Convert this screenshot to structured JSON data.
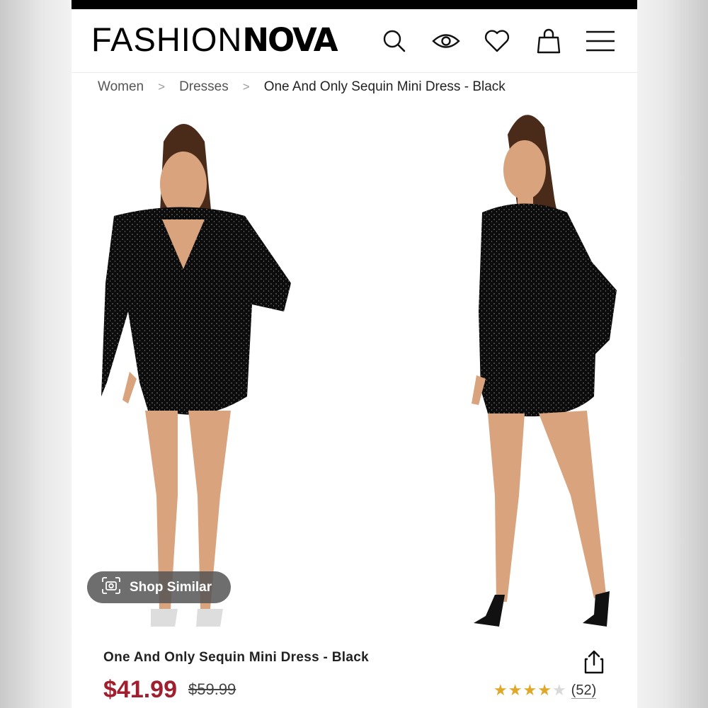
{
  "header": {
    "logo_light": "FASHION",
    "logo_bold": "NOVA",
    "icons": [
      "search-icon",
      "eye-icon",
      "heart-icon",
      "bag-icon",
      "menu-icon"
    ]
  },
  "breadcrumb": {
    "items": [
      "Women",
      "Dresses",
      "One And Only Sequin Mini Dress - Black"
    ],
    "separator": ">"
  },
  "gallery": {
    "shop_similar_label": "Shop Similar"
  },
  "product": {
    "title": "One And Only Sequin Mini Dress - Black",
    "price_sale": "$41.99",
    "price_original": "$59.99",
    "rating": 4,
    "rating_max": 5,
    "review_count": "(52)"
  },
  "colors": {
    "sale_price": "#a01e2e",
    "star": "#e0a829",
    "dress": "#0c0c0c",
    "skin": "#d9a37e",
    "hair": "#4a2b1a"
  }
}
